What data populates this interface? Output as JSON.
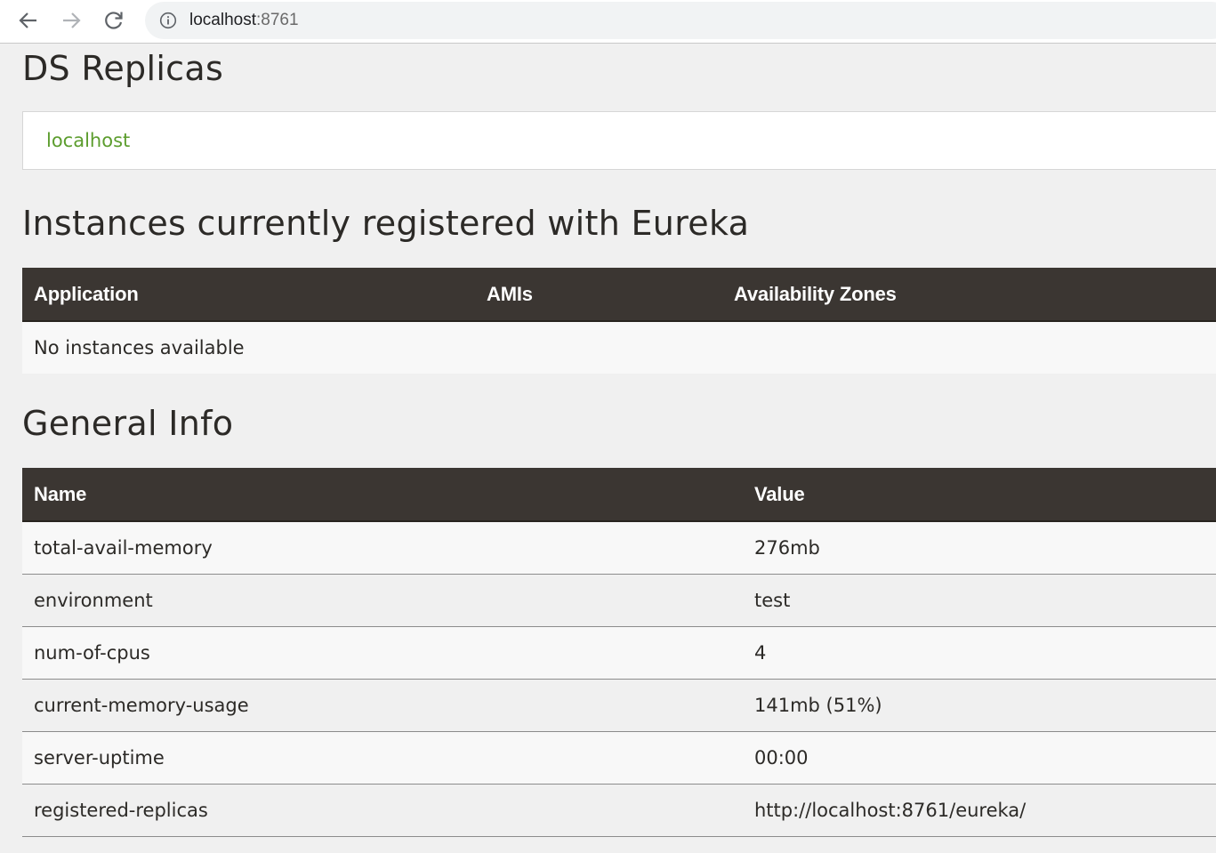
{
  "browser": {
    "url_host": "localhost",
    "url_port": ":8761"
  },
  "replicas": {
    "title": "DS Replicas",
    "items": [
      "localhost"
    ]
  },
  "instances": {
    "title": "Instances currently registered with Eureka",
    "columns": [
      "Application",
      "AMIs",
      "Availability Zones"
    ],
    "empty_message": "No instances available"
  },
  "general_info": {
    "title": "General Info",
    "columns": [
      "Name",
      "Value"
    ],
    "rows": [
      {
        "name": "total-avail-memory",
        "value": "276mb"
      },
      {
        "name": "environment",
        "value": "test"
      },
      {
        "name": "num-of-cpus",
        "value": "4"
      },
      {
        "name": "current-memory-usage",
        "value": "141mb (51%)"
      },
      {
        "name": "server-uptime",
        "value": "00:00"
      },
      {
        "name": "registered-replicas",
        "value": "http://localhost:8761/eureka/"
      }
    ]
  },
  "colors": {
    "table_header_bg": "#3b3632",
    "link_green": "#5c9d2e",
    "page_bg": "#f0f0f0"
  },
  "icons": {
    "back": "arrow-left-icon",
    "forward": "arrow-right-icon",
    "reload": "reload-icon",
    "site_info": "info-circle-icon"
  }
}
